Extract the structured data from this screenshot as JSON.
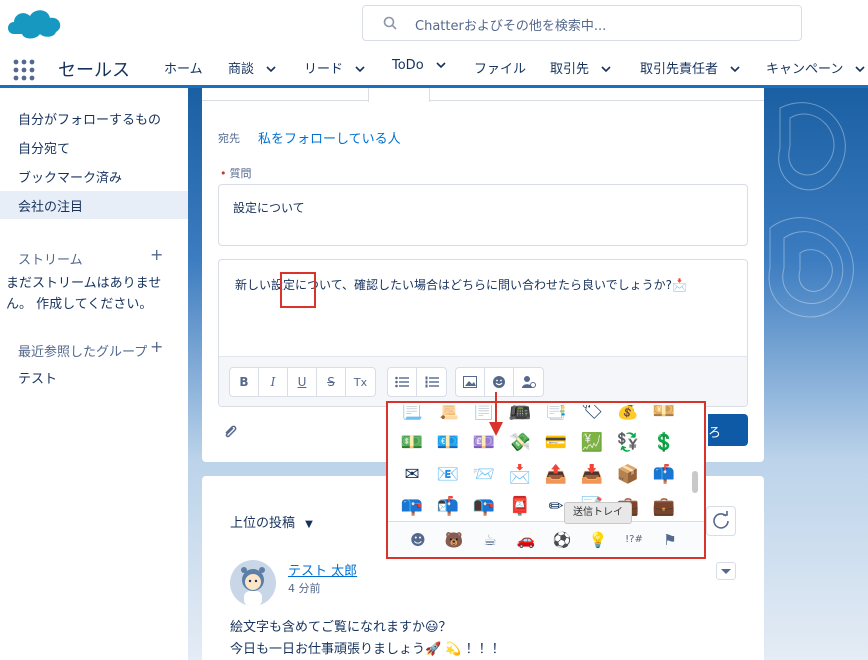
{
  "header": {
    "search_placeholder": "Chatterおよびその他を検索中..."
  },
  "nav": {
    "app_name": "セールス",
    "items": [
      {
        "label": "ホーム",
        "dropdown": false
      },
      {
        "label": "商談",
        "dropdown": true
      },
      {
        "label": "リード",
        "dropdown": true
      },
      {
        "label": "ToDo",
        "dropdown": true
      },
      {
        "label": "ファイル",
        "dropdown": false
      },
      {
        "label": "取引先",
        "dropdown": true
      },
      {
        "label": "取引先責任者",
        "dropdown": true
      },
      {
        "label": "キャンペーン",
        "dropdown": true
      }
    ]
  },
  "sidebar": {
    "links": [
      "自分がフォローするもの",
      "自分宛て",
      "ブックマーク済み",
      "会社の注目"
    ],
    "active_index": 3,
    "stream_heading": "ストリーム",
    "stream_empty": "まだストリームはありません。 作成してください。",
    "recent_groups_heading": "最近参照したグループ",
    "groups": [
      "テスト"
    ]
  },
  "composer": {
    "to_label": "宛先",
    "to_value": "私をフォローしている人",
    "question_label": "質問",
    "question_value": "設定について",
    "body_text": "新しい設定について、確認したい場合はどちらに問い合わせたら良いでしょうか?📩",
    "share_label": "ろ",
    "toolbar": {
      "bold": "B",
      "italic": "I",
      "underline": "U",
      "strike": "S",
      "clear": "Tx"
    }
  },
  "emoji_picker": {
    "rows": [
      [
        "📃",
        "📜",
        "📄",
        "📠",
        "📑",
        "🏷",
        "💰",
        "💴"
      ],
      [
        "💵",
        "💶",
        "💷",
        "💸",
        "💳",
        "💹",
        "💱",
        "💲"
      ],
      [
        "✉",
        "📧",
        "📨",
        "📩",
        "📤",
        "📥",
        "📦",
        "📫"
      ],
      [
        "📪",
        "📬",
        "📭",
        "📮",
        "✏",
        "📝",
        "💼",
        "💼"
      ]
    ],
    "categories": [
      {
        "icon": "smiley-icon",
        "glyph": "☻"
      },
      {
        "icon": "bear-icon",
        "glyph": "🐻"
      },
      {
        "icon": "coffee-icon",
        "glyph": "☕"
      },
      {
        "icon": "car-icon",
        "glyph": "🚗"
      },
      {
        "icon": "ball-icon",
        "glyph": "⚽"
      },
      {
        "icon": "lightbulb-icon",
        "glyph": "💡"
      },
      {
        "icon": "symbols-icon",
        "glyph": "!?#"
      },
      {
        "icon": "flag-icon",
        "glyph": "⚑"
      }
    ],
    "active_category": 5,
    "tooltip": "送信トレイ"
  },
  "feed": {
    "sort_label": "上位の投稿",
    "post": {
      "author": "テスト 太郎",
      "time": "4 分前",
      "line1": "絵文字も含めてご覧になれますか😃？",
      "line2": "今日も一日お仕事頑張りましょう🚀 💫 ！！！"
    }
  },
  "colors": {
    "brand_blue": "#0070d2",
    "highlight_red": "#d9342b",
    "nav_accent": "#1c6fbd"
  }
}
